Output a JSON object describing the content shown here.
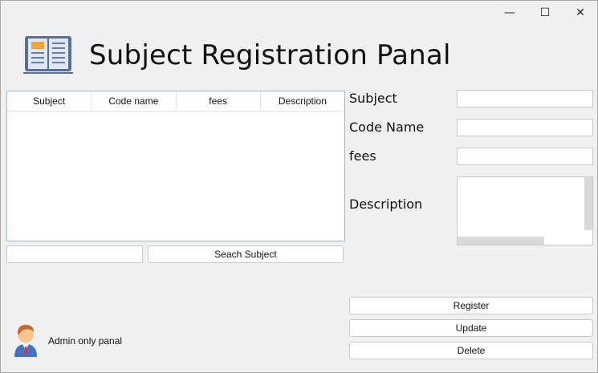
{
  "window": {
    "controls": {
      "minimize": "—",
      "maximize": "☐",
      "close": "✕"
    }
  },
  "header": {
    "title": "Subject Registration Panal",
    "icon": "book-icon"
  },
  "table": {
    "columns": [
      "Subject",
      "Code name",
      "fees",
      "Description"
    ],
    "rows": []
  },
  "search": {
    "value": "",
    "button_label": "Seach Subject"
  },
  "form": {
    "subject_label": "Subject",
    "code_name_label": "Code Name",
    "fees_label": "fees",
    "description_label": "Description",
    "subject_value": "",
    "code_name_value": "",
    "fees_value": "",
    "description_value": ""
  },
  "actions": {
    "register_label": "Register",
    "update_label": "Update",
    "delete_label": "Delete"
  },
  "footer": {
    "admin_text": "Admin only panal",
    "icon": "admin-avatar-icon"
  }
}
